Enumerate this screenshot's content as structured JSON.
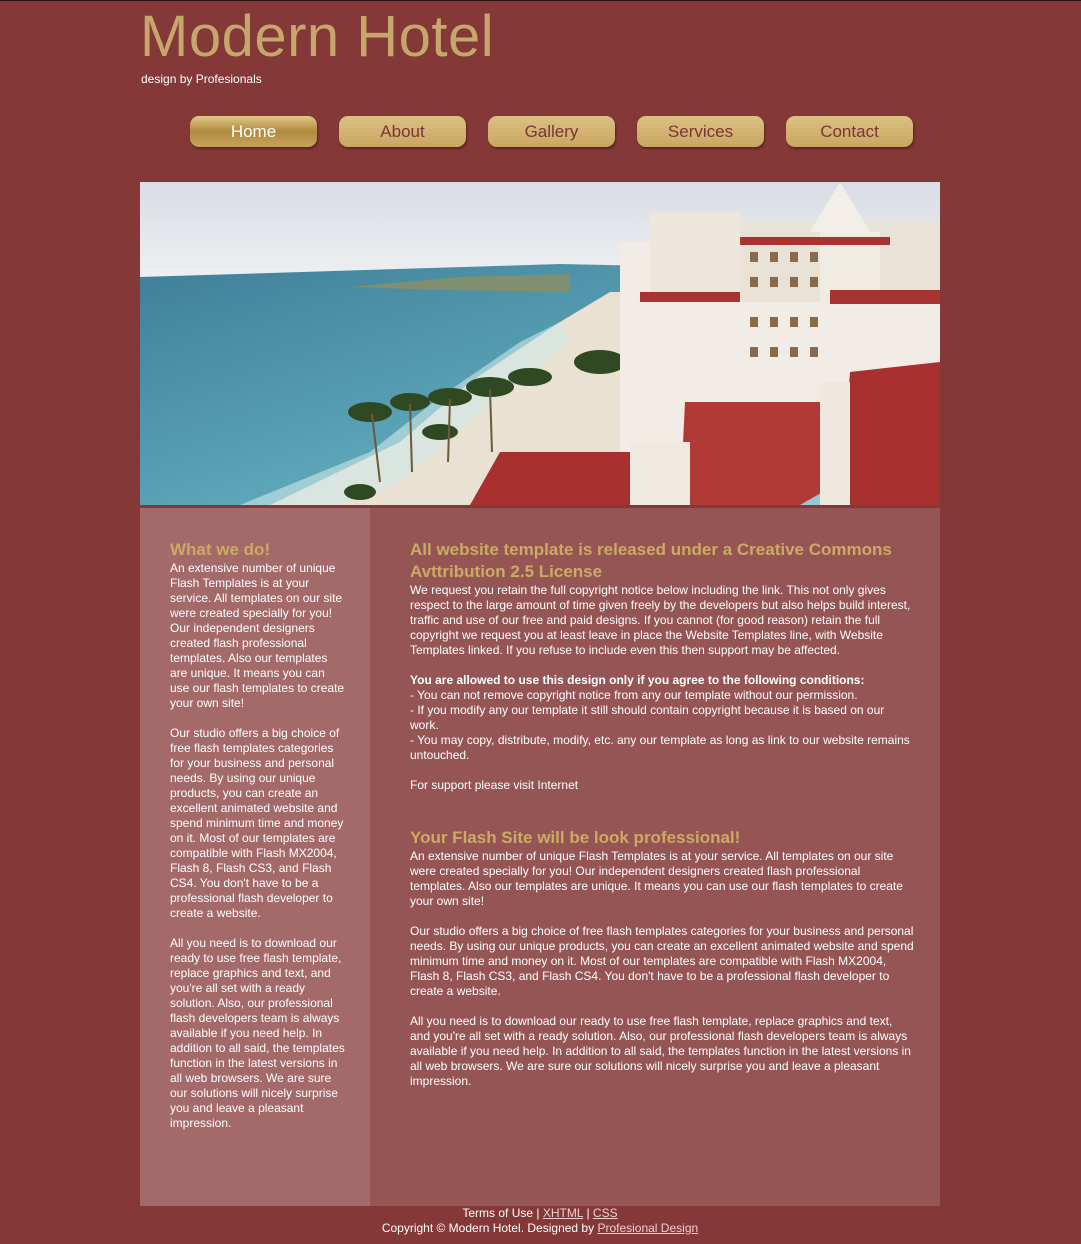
{
  "header": {
    "title": "Modern Hotel",
    "tagline": "design by Profesionals"
  },
  "nav": [
    {
      "label": "Home",
      "active": true
    },
    {
      "label": "About"
    },
    {
      "label": "Gallery"
    },
    {
      "label": "Services"
    },
    {
      "label": "Contact"
    }
  ],
  "sidebar": {
    "heading": "What we do!",
    "paragraphs": [
      "An extensive number of unique Flash Templates is at your service. All templates on our site were created specially for you! Our independent designers created flash professional templates. Also our templates are unique. It means you can use our flash templates to create your own site!",
      "Our studio offers a big choice of free flash templates categories for your business and personal needs. By using our unique products, you can create an excellent animated website and spend minimum time and money on it. Most of our templates are compatible with Flash MX2004, Flash 8, Flash CS3, and Flash CS4. You don't have to be a professional flash developer to create a website.",
      "All you need is to download our ready to use free flash template, replace graphics and text, and you're all set with a ready solution. Also, our professional flash developers team is always available if you need help. In addition to all said, the templates function in the latest versions in all web browsers. We are sure our solutions will nicely surprise you and leave a pleasant impression."
    ]
  },
  "main": {
    "section1": {
      "heading": "All website template is released under a Creative Commons Avttribution 2.5 License",
      "intro": "We request you retain the full copyright notice below including the link. This not only gives respect to the large amount of time given freely by the developers but also helps build interest, traffic and use of our free and paid designs. If you cannot (for good reason) retain the full copyright we request you at least leave in place the Website Templates line, with Website Templates linked. If you refuse to include even this then support may be affected.",
      "conditions_title": "You are allowed to use this design only if you agree to the following conditions:",
      "conditions": [
        "- You can not remove copyright notice from any our template without our permission.",
        "- If you modify any our template it still should contain copyright because it is based on our work.",
        "- You may copy, distribute, modify, etc. any our template as long as link to our website remains untouched."
      ],
      "support": "For support please visit Internet"
    },
    "section2": {
      "heading": "Your Flash Site will be look professional!",
      "paragraphs": [
        "An extensive number of unique Flash Templates is at your service. All templates on our site were created specially for you! Our independent designers created flash professional templates. Also our templates are unique. It means you can use our flash templates to create your own site!",
        "Our studio offers a big choice of free flash templates categories for your business and personal needs. By using our unique products, you can create an excellent animated website and spend minimum time and money on it. Most of our templates are compatible with Flash MX2004, Flash 8, Flash CS3, and Flash CS4. You don't have to be a professional flash developer to create a website.",
        "All you need is to download our ready to use free flash template, replace graphics and text, and you're all set with a ready solution. Also, our professional flash developers team is always available if you need help. In addition to all said, the templates function in the latest versions in all web browsers. We are sure our solutions will nicely surprise you and leave a pleasant impression."
      ]
    }
  },
  "footer": {
    "terms": "Terms of Use",
    "sep": "|",
    "xhtml": "XHTML",
    "css": "CSS",
    "copyright": "Copyright © Modern Hotel. Designed by",
    "designer": "Profesional Design"
  },
  "colors": {
    "background": "#843838",
    "accent_gold": "#c6a66a",
    "sidebar": "#a46a6a",
    "content": "#955555"
  }
}
